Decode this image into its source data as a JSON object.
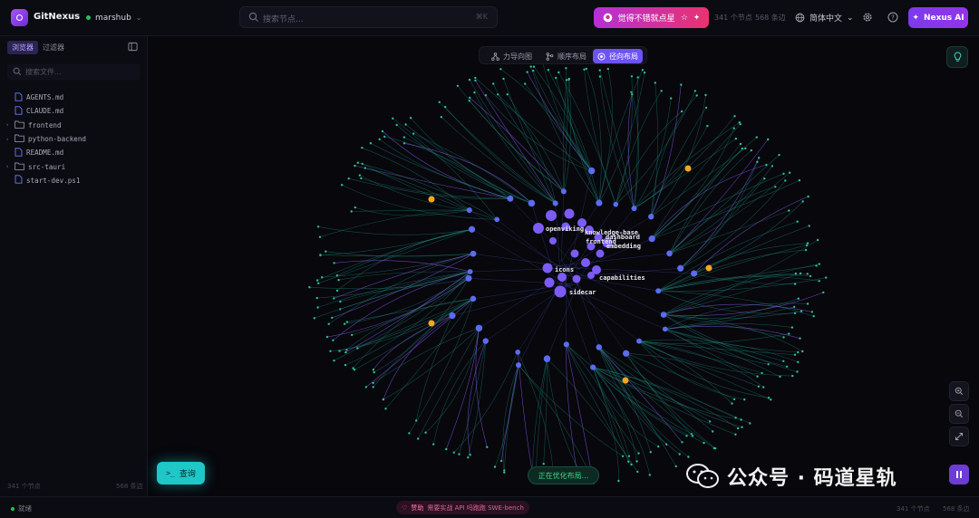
{
  "header": {
    "app_name": "GitNexus",
    "repo": "marshub",
    "search_placeholder": "搜索节点...",
    "search_shortcut": "⌘K",
    "star_label": "觉得不错就点星",
    "nodes_stat": "341 个节点",
    "edges_stat": "568 条边",
    "language": "简体中文",
    "ai_label": "Nexus AI"
  },
  "sidebar": {
    "tabs": [
      "浏览器",
      "过滤器"
    ],
    "file_search_placeholder": "搜索文件...",
    "files": [
      {
        "name": "AGENTS.md",
        "type": "file"
      },
      {
        "name": "CLAUDE.md",
        "type": "file"
      },
      {
        "name": "frontend",
        "type": "folder"
      },
      {
        "name": "python-backend",
        "type": "folder"
      },
      {
        "name": "README.md",
        "type": "file"
      },
      {
        "name": "src-tauri",
        "type": "folder"
      },
      {
        "name": "start-dev.ps1",
        "type": "file"
      }
    ],
    "nodes_stat": "341 个节点",
    "edges_stat": "568 条边"
  },
  "canvas": {
    "layout_buttons": [
      "力导向图",
      "顺序布局",
      "径向布局"
    ],
    "active_layout": "径向布局",
    "node_labels": [
      "openviking",
      "knowledge-base",
      "dashboard",
      "frontend",
      "embedding",
      "icons",
      "capabilities",
      "sidecar"
    ],
    "query_label": "查询",
    "optimizing_label": "正在优化布局...",
    "watermark": "公众号 · 码道星轨"
  },
  "footer": {
    "status": "就绪",
    "sponsor_label": "赞助",
    "sponsor_text": "需要实战 API 吗跑跑 SWE-bench",
    "nodes_stat": "341 个节点",
    "edges_stat": "568 条边"
  },
  "colors": {
    "accent": "#6d52f5",
    "node": "#5b6cf0",
    "node_hub": "#7c5cf5",
    "node_orange": "#f5a623",
    "edge": "#1f8f80",
    "edge_purple": "#8b5cf6",
    "teal": "#20c7c7",
    "star_gradient_start": "#b62fd6",
    "star_gradient_end": "#e8336f"
  },
  "icons": [
    "logo-icon",
    "search-icon",
    "github-icon",
    "star-icon",
    "sparkle-icon",
    "globe-icon",
    "gear-icon",
    "help-icon",
    "ai-sparkle-icon",
    "sidebar-collapse-icon",
    "file-icon",
    "folder-icon",
    "chevron-right-icon",
    "force-layout-icon",
    "tree-layout-icon",
    "radial-layout-icon",
    "bulb-icon",
    "zoom-in-icon",
    "zoom-out-icon",
    "fit-icon",
    "pause-icon",
    "terminal-icon",
    "heart-icon"
  ]
}
